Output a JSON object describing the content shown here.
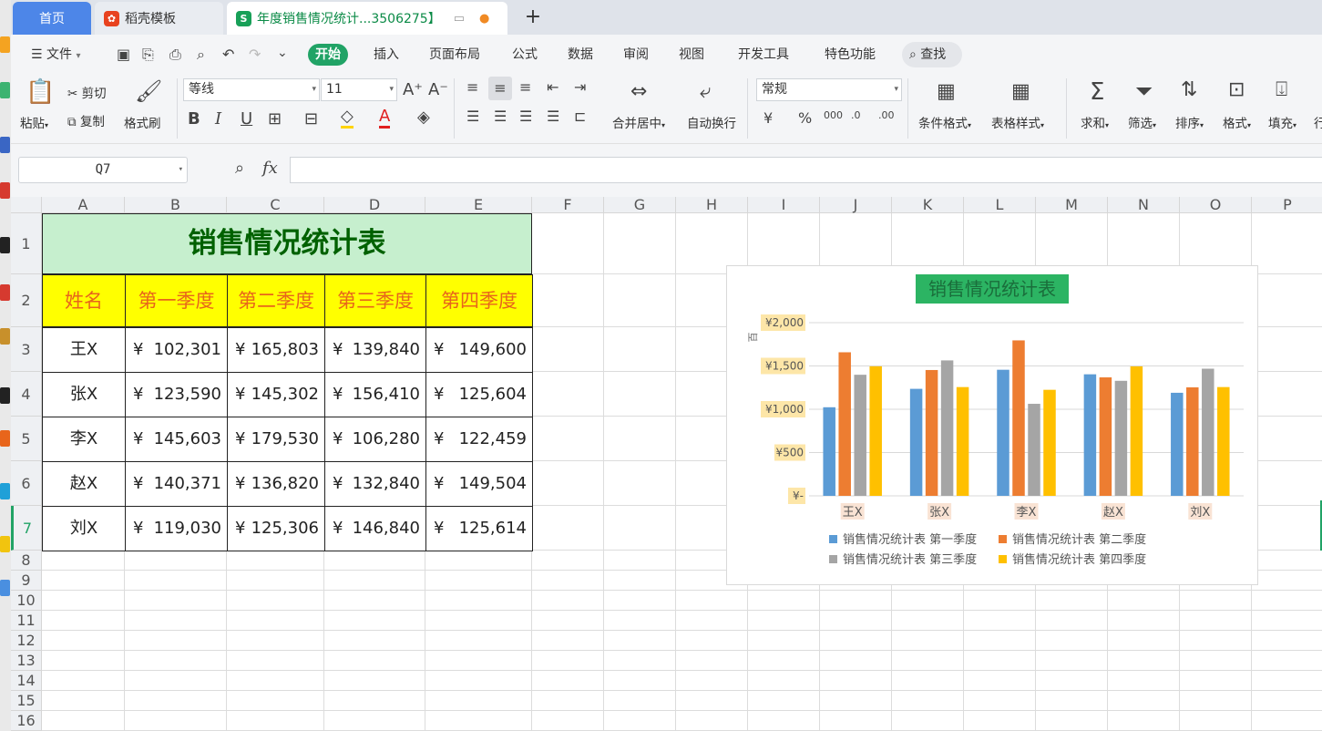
{
  "tabs": [
    {
      "label": "首页"
    },
    {
      "label": "稻壳模板"
    },
    {
      "label": "年度销售情况统计...3506275】"
    }
  ],
  "menu": {
    "file": "文件",
    "tabs": [
      "开始",
      "插入",
      "页面布局",
      "公式",
      "数据",
      "审阅",
      "视图",
      "开发工具",
      "特色功能"
    ],
    "active": "开始",
    "search": "查找"
  },
  "ribbon": {
    "paste": "粘贴",
    "cut": "剪切",
    "copy": "复制",
    "format_painter": "格式刷",
    "font_name": "等线",
    "font_size": "11",
    "merge_center": "合并居中",
    "wrap_text": "自动换行",
    "number_format": "常规",
    "cond_format": "条件格式",
    "table_style": "表格样式",
    "sum": "求和",
    "filter": "筛选",
    "sort": "排序",
    "format": "格式",
    "fill": "填充",
    "more": "行"
  },
  "formula": {
    "cell_ref": "Q7",
    "fx_label": "fx",
    "content": ""
  },
  "grid": {
    "columns": [
      "A",
      "B",
      "C",
      "D",
      "E",
      "F",
      "G",
      "H",
      "I",
      "J",
      "K",
      "L",
      "M",
      "N",
      "O",
      "P"
    ],
    "rows": [
      "1",
      "2",
      "3",
      "4",
      "5",
      "6",
      "7",
      "8",
      "9",
      "10",
      "11",
      "12",
      "13",
      "14",
      "15",
      "16"
    ]
  },
  "table": {
    "title": "销售情况统计表",
    "headers": [
      "姓名",
      "第一季度",
      "第二季度",
      "第三季度",
      "第四季度"
    ],
    "currency": "¥",
    "rows": [
      {
        "name": "王X",
        "values": [
          "102,301",
          "165,803",
          "139,840",
          "149,600"
        ]
      },
      {
        "name": "张X",
        "values": [
          "123,590",
          "145,302",
          "156,410",
          "125,604"
        ]
      },
      {
        "name": "李X",
        "values": [
          "145,603",
          "179,530",
          "106,280",
          "122,459"
        ]
      },
      {
        "name": "赵X",
        "values": [
          "140,371",
          "136,820",
          "132,840",
          "149,504"
        ]
      },
      {
        "name": "刘X",
        "values": [
          "119,030",
          "125,306",
          "146,840",
          "125,614"
        ]
      }
    ]
  },
  "chart_data": {
    "type": "bar",
    "title": "销售情况统计表",
    "ylabel": "百",
    "categories": [
      "王X",
      "张X",
      "李X",
      "赵X",
      "刘X"
    ],
    "ytick_labels": [
      "¥2,000",
      "¥1,500",
      "¥1,000",
      "¥500",
      "¥-"
    ],
    "yticks": [
      2000,
      1500,
      1000,
      500,
      0
    ],
    "ylim": [
      0,
      2000
    ],
    "grid": true,
    "legend_position": "bottom",
    "series": [
      {
        "name": "销售情况统计表 第一季度",
        "color": "#5b9bd5",
        "values": [
          1023.01,
          1235.9,
          1456.03,
          1403.71,
          1190.3
        ]
      },
      {
        "name": "销售情况统计表 第二季度",
        "color": "#ed7d31",
        "values": [
          1658.03,
          1453.02,
          1795.3,
          1368.2,
          1253.06
        ]
      },
      {
        "name": "销售情况统计表 第三季度",
        "color": "#a5a5a5",
        "values": [
          1398.4,
          1564.1,
          1062.8,
          1328.4,
          1468.4
        ]
      },
      {
        "name": "销售情况统计表 第四季度",
        "color": "#ffc000",
        "values": [
          1496.0,
          1256.04,
          1224.59,
          1495.04,
          1256.14
        ]
      }
    ]
  }
}
